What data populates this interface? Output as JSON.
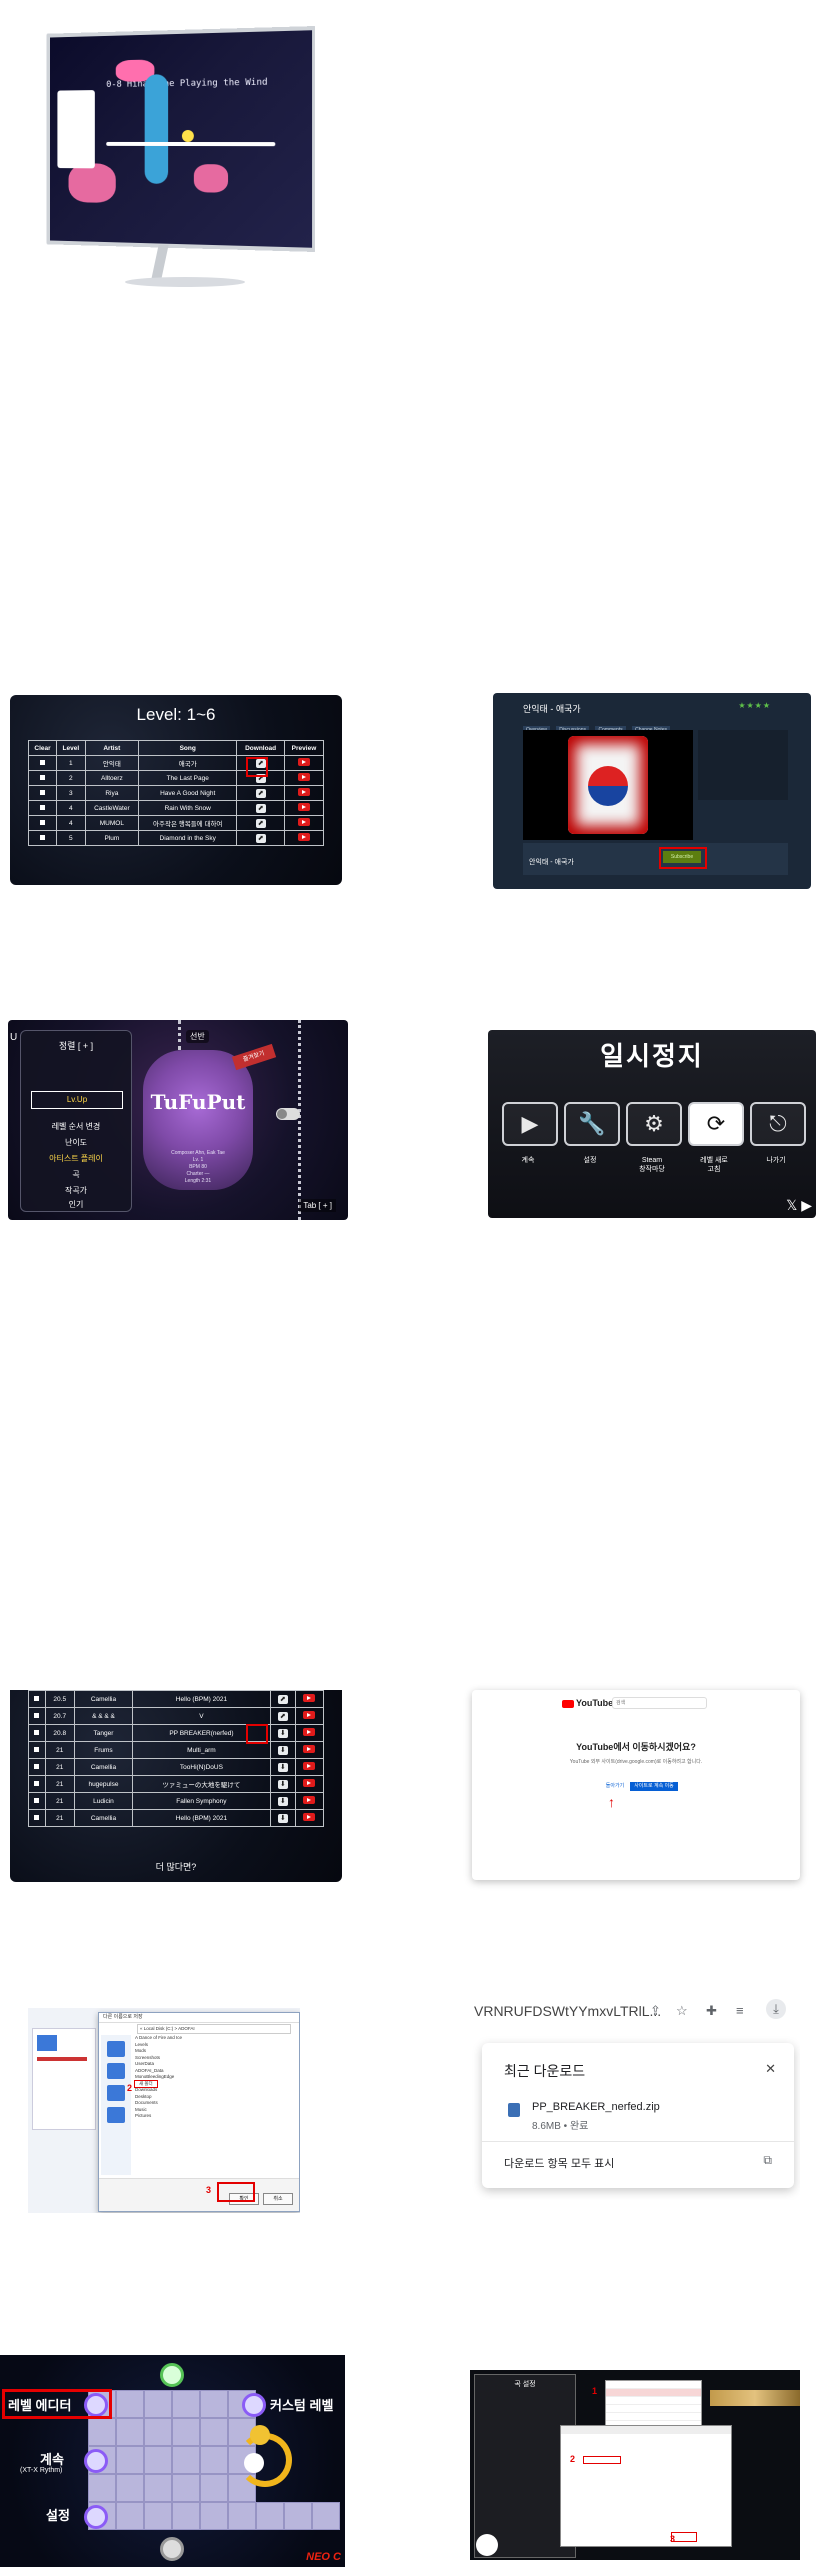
{
  "monitor": {
    "game_text": "0-8  Hina! The Playing the Wind"
  },
  "level_table": {
    "title": "Level: 1~6",
    "headers": [
      "Clear",
      "Level",
      "Artist",
      "Song",
      "Download",
      "Preview"
    ],
    "rows": [
      {
        "level": "1",
        "artist": "안익태",
        "song": "애국가"
      },
      {
        "level": "2",
        "artist": "Alltoerz",
        "song": "The Last Page"
      },
      {
        "level": "3",
        "artist": "Riya",
        "song": "Have A Good Night"
      },
      {
        "level": "4",
        "artist": "CastleWater",
        "song": "Rain With Snow"
      },
      {
        "level": "4",
        "artist": "MUMOL",
        "song": "아주작은 행복들에 대하여"
      },
      {
        "level": "5",
        "artist": "Plum",
        "song": "Diamond in the Sky"
      }
    ]
  },
  "steam_page": {
    "title": "안익태 - 애국가",
    "rating": "★★★★",
    "tabs": [
      "Overview",
      "Discussions",
      "Comments",
      "Change Notes"
    ],
    "item_name": "안익태 - 애국가",
    "subscribe_label": "Subscribe"
  },
  "game_menu": {
    "title": "정렬 [ + ]",
    "selected": "Lv.Up",
    "items": [
      "레벨 순서 변경",
      "난이도",
      "아티스트 플레이",
      "곡",
      "작곡가",
      "인기"
    ],
    "cover_title": "TuFuPut",
    "cover_info": [
      "Composer Ahn, Eak Tae",
      "Lv. 1",
      "BPM 80",
      "Charter — ",
      "Length 2:31"
    ],
    "favorite": "즐겨찾기",
    "shelf": "선반",
    "hint": "Tab [ + ]",
    "mini_label": "U"
  },
  "pause_menu": {
    "title": "일시정지",
    "buttons": [
      {
        "icon": "▶",
        "label": "계속"
      },
      {
        "icon": "🔧",
        "label": "설정"
      },
      {
        "icon": "⚙",
        "label": "Steam\n창작마당"
      },
      {
        "icon": "⟳",
        "label": "레벨 새로\n고침"
      },
      {
        "icon": "⎋",
        "label": "나가기"
      }
    ]
  },
  "level_table_2": {
    "rows": [
      {
        "level": "20.5",
        "artist": "Camellia",
        "song": "Hello (BPM) 2021"
      },
      {
        "level": "20.7",
        "artist": "& & & &",
        "song": "V"
      },
      {
        "level": "20.8",
        "artist": "Tanger",
        "song": "PP BREAKER(nerfed)"
      },
      {
        "level": "21",
        "artist": "Frums",
        "song": "Multi_arm"
      },
      {
        "level": "21",
        "artist": "Camellia",
        "song": "TooHi(N)DoUS"
      },
      {
        "level": "21",
        "artist": "hugepulse",
        "song": "ツァミューの大地を駆けて"
      },
      {
        "level": "21",
        "artist": "Ludicin",
        "song": "Fallen Symphony"
      },
      {
        "level": "21",
        "artist": "Camellia",
        "song": "Hello (BPM) 2021"
      }
    ],
    "more": "더 많다면?"
  },
  "youtube_dialog": {
    "brand": "YouTube",
    "search_placeholder": "검색",
    "question": "YouTube에서 이동하시겠어요?",
    "description": "YouTube 외부 사이트(drive.google.com)로 이동하려고 합니다.",
    "back": "돌아가기",
    "continue": "사이트로 계속 이동"
  },
  "file_dialog": {
    "window_title": "다른 이름으로 저장",
    "address": "« Local Disk (C:) > ADOFAI",
    "folders": [
      "A Dance of Fire and Ice",
      "Levels",
      "Mods",
      "Screenshots",
      "UserData",
      "ADOFAI_Data",
      "MonoBleedingEdge",
      "Downloads",
      "Desktop",
      "Documents",
      "Music",
      "Pictures"
    ],
    "highlighted": "새 폴더",
    "ok": "확인",
    "cancel": "취소",
    "step2": "2",
    "step3": "3"
  },
  "chrome_downloads": {
    "url": "VRNRUFDSWtYYmxvLTRlL...",
    "heading": "최근 다운로드",
    "file_name": "PP_BREAKER_nerfed.zip",
    "file_status": "8.6MB • 완료",
    "show_all": "다운로드 항목 모두 표시"
  },
  "level_editor": {
    "label_editor": "레벨 에디터",
    "label_custom": "커스텀 레벨",
    "label_continue": "계속",
    "label_continue_sub": "(XT-X Rythm)",
    "label_settings": "설정",
    "brand": "NEO C"
  },
  "final_editor": {
    "panel_title": "곡 설정",
    "step1": "1",
    "step2": "2",
    "step3": "3"
  }
}
